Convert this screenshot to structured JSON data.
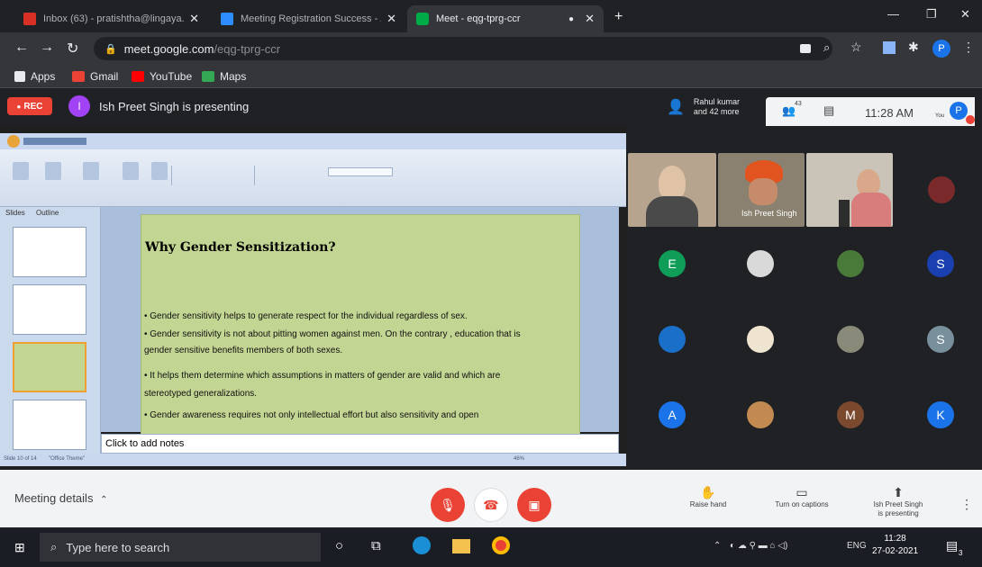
{
  "browser": {
    "tabs": [
      {
        "title": "Inbox (63) - pratishtha@lingaya...",
        "active": false,
        "icon": "gmail-icon"
      },
      {
        "title": "Meeting Registration Success - Z...",
        "active": false,
        "icon": "zoom-icon"
      },
      {
        "title": "Meet - eqg-tprg-ccr",
        "active": true,
        "icon": "meet-icon"
      }
    ],
    "new_tab": "+",
    "address": {
      "host": "meet.google.com",
      "path": "/eqg-tprg-ccr"
    },
    "profile_initial": "P",
    "bookmarks": [
      "Apps",
      "Gmail",
      "YouTube",
      "Maps"
    ]
  },
  "meet": {
    "rec_label": "REC",
    "presenter_initial": "I",
    "presenting_text": "Ish Preet Singh is presenting",
    "people_line1": "Rahul kumar",
    "people_line2": "and 42 more",
    "participant_count": "43",
    "time": "11:28 AM",
    "you_label": "You",
    "you_initial": "P"
  },
  "presentation": {
    "slides_tab": "Slides",
    "outline_tab": "Outline",
    "slide_title": "Why Gender Sensitization?",
    "bullets": [
      "• Gender sensitivity helps to generate respect for the individual regardless of sex.",
      "• Gender sensitivity is not about pitting women against men. On the contrary , education that is",
      "gender sensitive benefits members of both sexes.",
      "• It helps them determine which assumptions in matters of gender are valid and which are",
      "stereotyped generalizations.",
      "• Gender awareness requires not only intellectual effort but also sensitivity and open"
    ],
    "notes_placeholder": "Click to add notes",
    "status_left": "Slide 10 of 14",
    "status_theme": "\"Office Theme\"",
    "zoom": "46%"
  },
  "participants": {
    "video_tiles": [
      {
        "name": ""
      },
      {
        "name": "Ish Preet Singh"
      },
      {
        "name": ""
      }
    ],
    "avatars": [
      {
        "initial": "E",
        "color": "#0f9d58"
      },
      {
        "initial": "S",
        "color": "#1a3fb0"
      },
      {
        "initial": "S",
        "color": "#78909c"
      },
      {
        "initial": "A",
        "color": "#1a73e8"
      },
      {
        "initial": "M",
        "color": "#7b4a2e"
      },
      {
        "initial": "K",
        "color": "#1a73e8"
      }
    ]
  },
  "controls": {
    "meeting_details": "Meeting details",
    "raise_hand": "Raise hand",
    "captions": "Turn on captions",
    "presenting_line1": "Ish Preet Singh",
    "presenting_line2": "is presenting"
  },
  "taskbar": {
    "search_placeholder": "Type here to search",
    "lang": "ENG",
    "time": "11:28",
    "date": "27-02-2021",
    "notification_count": "3"
  },
  "colors": {
    "red": "#ea4335",
    "slide_bg": "#c3d592",
    "meet_dark": "#202124"
  }
}
